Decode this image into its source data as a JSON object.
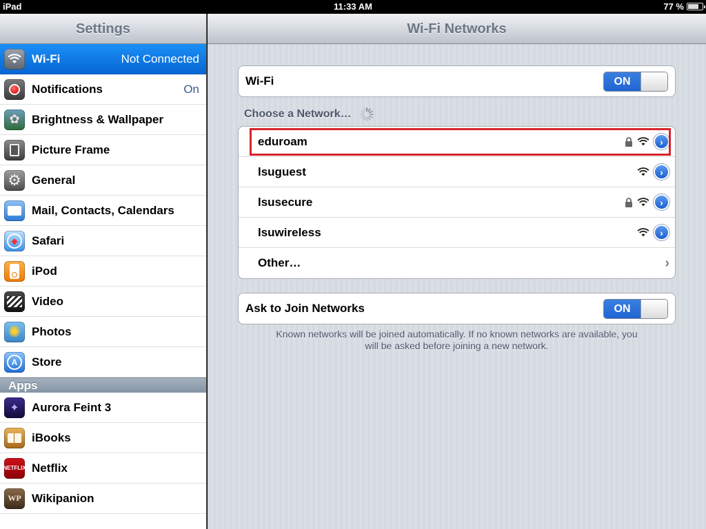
{
  "status_bar": {
    "device": "iPad",
    "time": "11:33 AM",
    "battery": "77 %",
    "battery_level": 0.77
  },
  "sidebar": {
    "title": "Settings",
    "items": [
      {
        "label": "Wi-Fi",
        "value": "Not Connected",
        "icon": "wifi-icon",
        "selected": true
      },
      {
        "label": "Notifications",
        "value": "On",
        "icon": "notifications-icon"
      },
      {
        "label": "Brightness & Wallpaper",
        "value": "",
        "icon": "brightness-icon"
      },
      {
        "label": "Picture Frame",
        "value": "",
        "icon": "picture-frame-icon"
      },
      {
        "label": "General",
        "value": "",
        "icon": "gear-icon"
      },
      {
        "label": "Mail, Contacts, Calendars",
        "value": "",
        "icon": "mail-icon"
      },
      {
        "label": "Safari",
        "value": "",
        "icon": "compass-icon"
      },
      {
        "label": "iPod",
        "value": "",
        "icon": "ipod-icon"
      },
      {
        "label": "Video",
        "value": "",
        "icon": "video-icon"
      },
      {
        "label": "Photos",
        "value": "",
        "icon": "photos-icon"
      },
      {
        "label": "Store",
        "value": "",
        "icon": "store-icon"
      }
    ],
    "apps_header": "Apps",
    "apps": [
      {
        "label": "Aurora Feint 3",
        "icon": "aurora-feint-icon"
      },
      {
        "label": "iBooks",
        "icon": "ibooks-icon"
      },
      {
        "label": "Netflix",
        "icon": "netflix-icon"
      },
      {
        "label": "Wikipanion",
        "icon": "wikipanion-icon"
      }
    ]
  },
  "main": {
    "title": "Wi-Fi Networks",
    "wifi_label": "Wi-Fi",
    "wifi_toggle": "ON",
    "choose_label": "Choose a Network…",
    "networks": [
      {
        "name": "eduroam",
        "locked": true
      },
      {
        "name": "lsuguest",
        "locked": false
      },
      {
        "name": "lsusecure",
        "locked": true
      },
      {
        "name": "lsuwireless",
        "locked": false
      }
    ],
    "other_label": "Other…",
    "ask_label": "Ask to Join Networks",
    "ask_toggle": "ON",
    "footnote_line1": "Known networks will be joined automatically.  If no known networks are available, you",
    "footnote_line2": "will be asked before joining a new network."
  },
  "colors": {
    "highlight": "#d8232a",
    "selected": "#0a72e8",
    "toggle_on": "#2a6fdb"
  }
}
